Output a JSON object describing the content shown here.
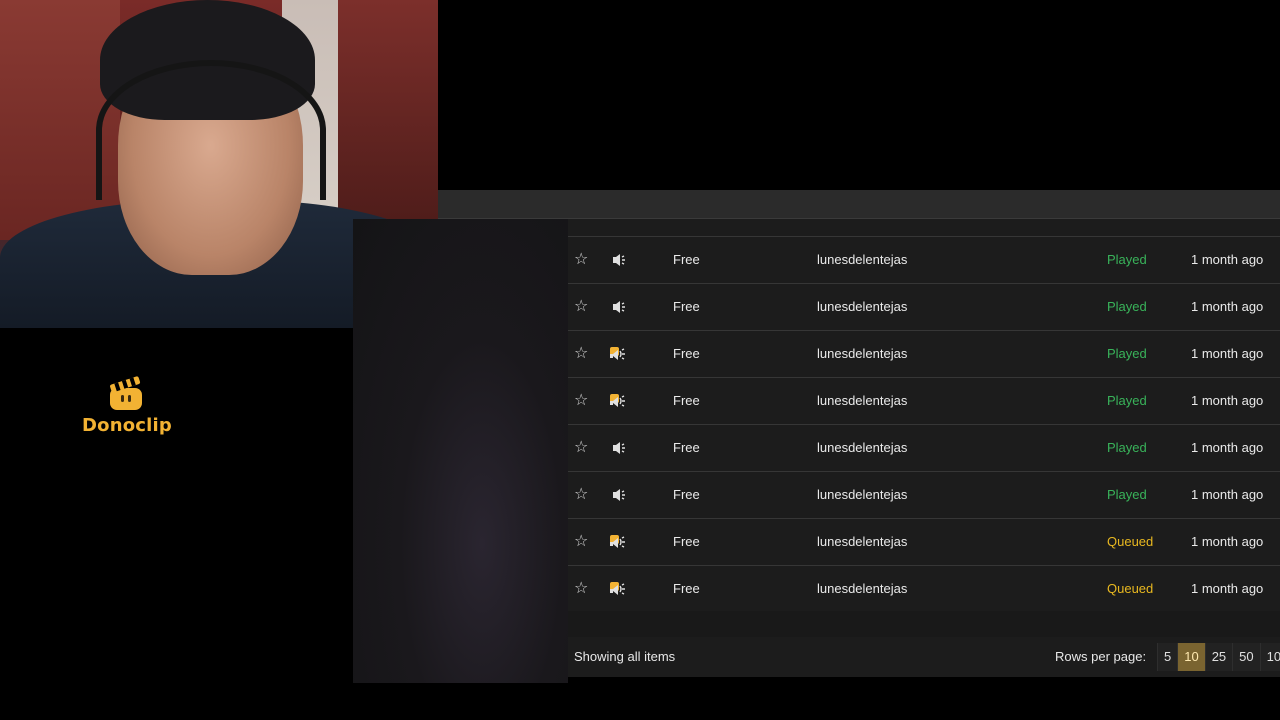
{
  "brand": {
    "name": "Donoclip",
    "accent": "#f2b233"
  },
  "colors": {
    "played": "#39b35a",
    "queued": "#e8b820",
    "active_page": "#7a6430"
  },
  "rows": [
    {
      "icon": "speaker-icon",
      "type": "Free",
      "user": "lunesdelentejas",
      "status": "Played",
      "time": "1 month ago"
    },
    {
      "icon": "speaker-icon",
      "type": "Free",
      "user": "lunesdelentejas",
      "status": "Played",
      "time": "1 month ago"
    },
    {
      "icon": "video-speaker-icon",
      "type": "Free",
      "user": "lunesdelentejas",
      "status": "Played",
      "time": "1 month ago"
    },
    {
      "icon": "video-speaker-icon",
      "type": "Free",
      "user": "lunesdelentejas",
      "status": "Played",
      "time": "1 month ago"
    },
    {
      "icon": "speaker-icon",
      "type": "Free",
      "user": "lunesdelentejas",
      "status": "Played",
      "time": "1 month ago"
    },
    {
      "icon": "speaker-icon",
      "type": "Free",
      "user": "lunesdelentejas",
      "status": "Played",
      "time": "1 month ago"
    },
    {
      "icon": "video-speaker-icon",
      "type": "Free",
      "user": "lunesdelentejas",
      "status": "Queued",
      "time": "1 month ago"
    },
    {
      "icon": "video-speaker-icon",
      "type": "Free",
      "user": "lunesdelentejas",
      "status": "Queued",
      "time": "1 month ago"
    }
  ],
  "footer": {
    "showing": "Showing all items",
    "rows_per_page_label": "Rows per page:",
    "page_sizes": [
      "5",
      "10",
      "25",
      "50",
      "10"
    ],
    "selected_page_size": "10"
  }
}
